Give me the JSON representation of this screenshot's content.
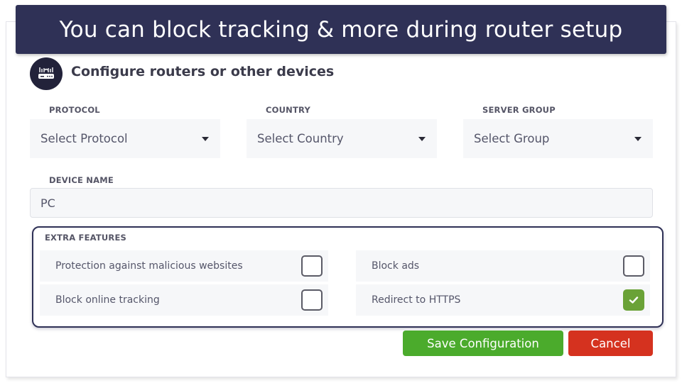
{
  "banner": {
    "text": "You can block tracking & more during router setup",
    "background": "#2f3156"
  },
  "header": {
    "icon": "router-icon",
    "title": "Configure routers or other devices"
  },
  "form": {
    "protocol": {
      "label": "PROTOCOL",
      "value": "Select Protocol"
    },
    "country": {
      "label": "COUNTRY",
      "value": "Select Country"
    },
    "server_group": {
      "label": "SERVER GROUP",
      "value": "Select Group"
    },
    "device_name": {
      "label": "DEVICE NAME",
      "value": "PC"
    }
  },
  "extras": {
    "title": "EXTRA FEATURES",
    "items": [
      {
        "label": "Protection against malicious websites",
        "checked": false
      },
      {
        "label": "Block ads",
        "checked": false
      },
      {
        "label": "Block online tracking",
        "checked": false
      },
      {
        "label": "Redirect to HTTPS",
        "checked": true
      }
    ]
  },
  "actions": {
    "save_label": "Save Configuration",
    "cancel_label": "Cancel",
    "save_color": "#4bab2c",
    "cancel_color": "#d5321f"
  },
  "colors": {
    "checked": "#6aa237",
    "accent": "#2f3156"
  }
}
